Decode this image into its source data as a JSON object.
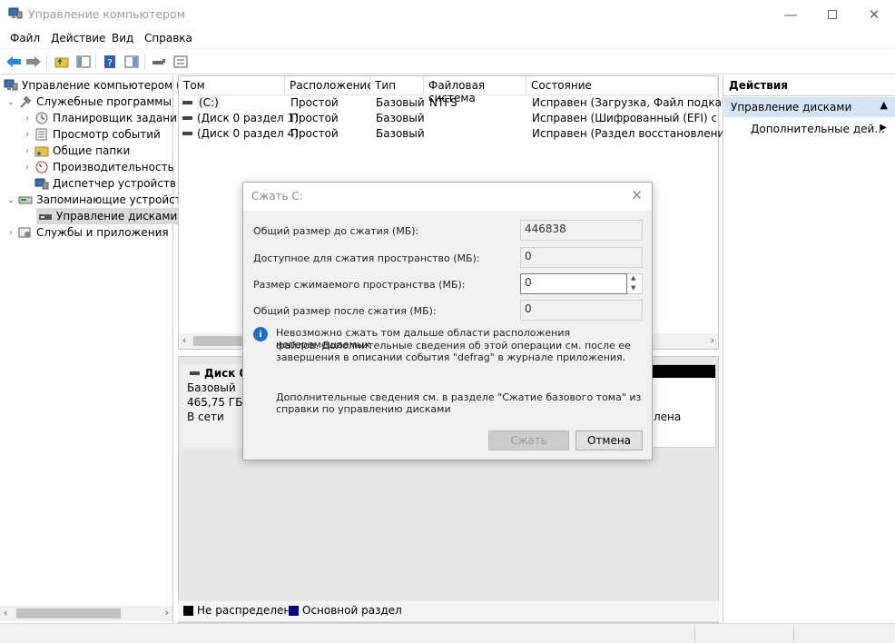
{
  "window": {
    "title": "Управление компьютером"
  },
  "menu": [
    "Файл",
    "Действие",
    "Вид",
    "Справка"
  ],
  "tree": {
    "root": "Управление компьютером (л",
    "utilities": "Служебные программы",
    "task_scheduler": "Планировщик заданий",
    "event_viewer": "Просмотр событий",
    "shared_folders": "Общие папки",
    "performance": "Производительность",
    "device_manager": "Диспетчер устройств",
    "storage": "Запоминающие устройст",
    "disk_management": "Управление дисками",
    "services": "Службы и приложения"
  },
  "volumes": {
    "columns": [
      "Том",
      "Расположение",
      "Тип",
      "Файловая система",
      "Состояние"
    ],
    "rows": [
      [
        "(C:)",
        "Простой",
        "Базовый",
        "NTFS",
        "Исправен (Загрузка, Файл подкачки,"
      ],
      [
        "(Диск 0 раздел 1)",
        "Простой",
        "Базовый",
        "",
        "Исправен (Шифрованный (EFI) систе"
      ],
      [
        "(Диск 0 раздел 4)",
        "Простой",
        "Базовый",
        "",
        "Исправен (Раздел восстановления)"
      ]
    ]
  },
  "disk": {
    "name": "Диск 0",
    "type": "Базовый",
    "size": "465,75 ГБ",
    "status": "В сети",
    "partial_status": "лена"
  },
  "legend": {
    "unallocated": "Не распределена",
    "primary": "Основной раздел",
    "unallocated_color": "#000000",
    "primary_color": "#000080"
  },
  "actions": {
    "header": "Действия",
    "section": "Управление дисками",
    "more": "Дополнительные дей..."
  },
  "dialog": {
    "title": "Сжать C:",
    "total_label": "Общий размер до сжатия (МБ):",
    "total_value": "446838",
    "available_label": "Доступное для сжатия пространство (МБ):",
    "available_value": "0",
    "shrink_label": "Размер сжимаемого пространства (МБ):",
    "shrink_value": "0",
    "after_label": "Общий размер после сжатия (МБ):",
    "after_value": "0",
    "info_line1": "Невозможно сжать том дальше области расположения неперемещаемых",
    "info_line2": "файлов. Дополнительные сведения об этой операции см. после ее",
    "info_line3": "завершения в описании события \"defrag\" в журнале приложения.",
    "help_line1": "Дополнительные сведения см. в разделе \"Сжатие базового тома\" из",
    "help_line2": "справки по управлению дисками",
    "shrink_button": "Сжать",
    "cancel_button": "Отмена"
  }
}
